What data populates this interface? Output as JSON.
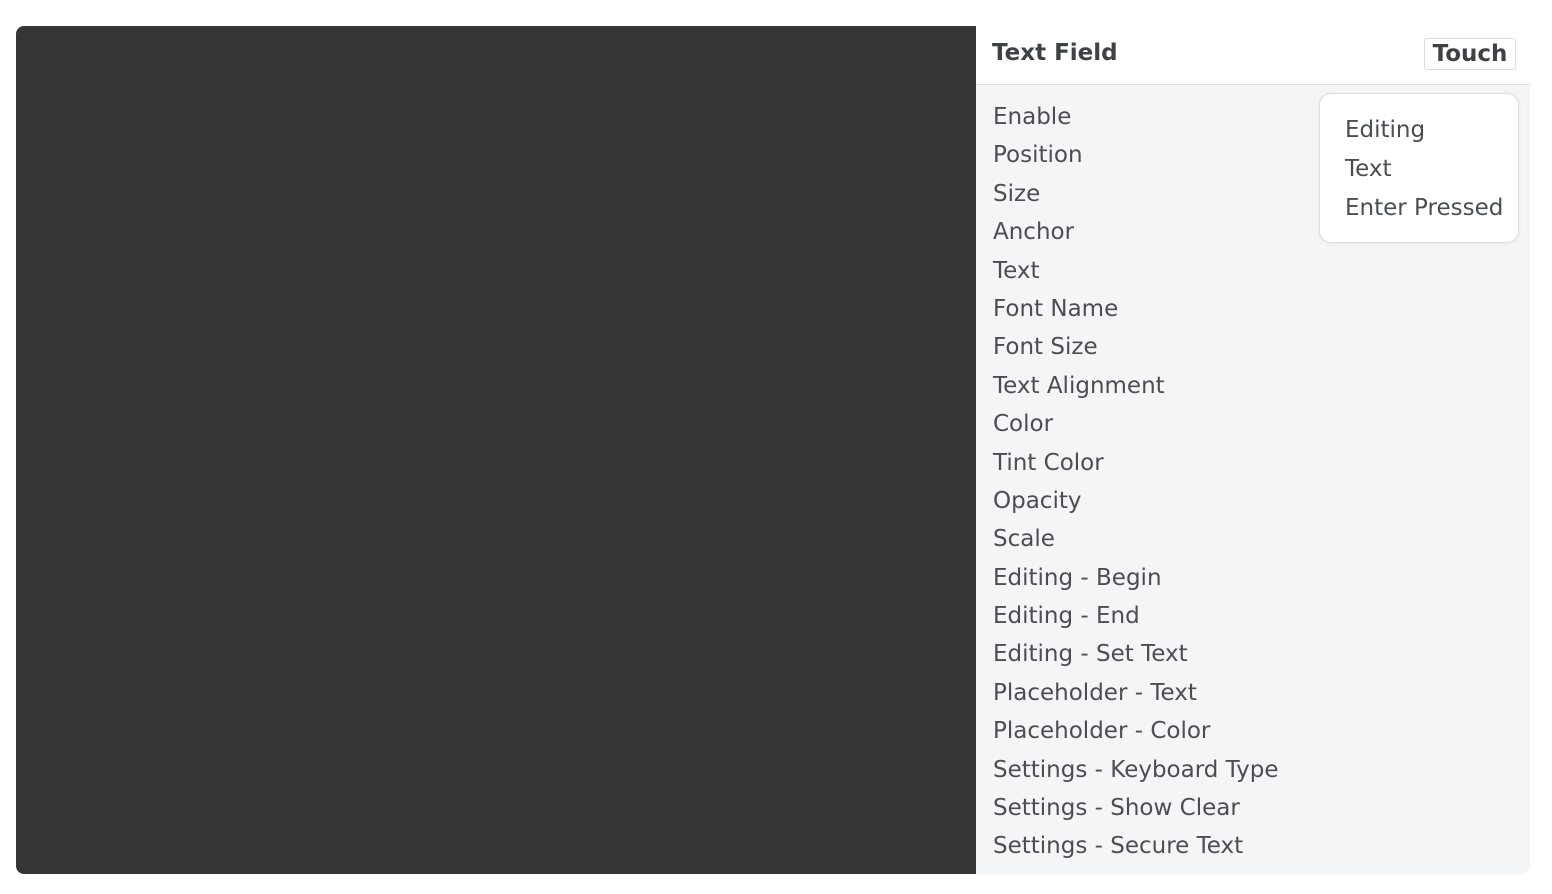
{
  "panel": {
    "title": "Text Field",
    "touch_label": "Touch"
  },
  "properties": [
    "Enable",
    "Position",
    "Size",
    "Anchor",
    "Text",
    "Font Name",
    "Font Size",
    "Text Alignment",
    "Color",
    "Tint Color",
    "Opacity",
    "Scale",
    "Editing - Begin",
    "Editing - End",
    "Editing - Set Text",
    "Placeholder - Text",
    "Placeholder - Color",
    "Settings - Keyboard Type",
    "Settings - Show Clear",
    "Settings - Secure Text"
  ],
  "popup": {
    "items": [
      "Editing",
      "Text",
      "Enter Pressed"
    ]
  },
  "colors": {
    "canvas_bg": "#353535",
    "panel_bg": "#f4f5f7",
    "text": "#4a4e54"
  }
}
